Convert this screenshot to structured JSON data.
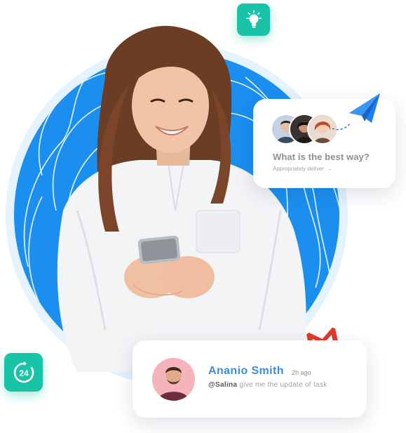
{
  "question_card": {
    "title": "What is the best way?",
    "link_text": "Appropriately deliver",
    "link_arrow": "→"
  },
  "message_card": {
    "sender_name": "Ananio Smith",
    "time": "2h ago",
    "mention": "@Salina",
    "message": "give me the update of task"
  },
  "icons": {
    "bulb": "lightbulb-icon",
    "availability": "24-hours-icon",
    "send": "paper-plane-icon",
    "mail": "gmail-icon"
  },
  "colors": {
    "circle_blue": "#1a8ff0",
    "badge_teal": "#18c3a8",
    "name_blue": "#3b8fd9",
    "gmail_red": "#e23a2c"
  }
}
